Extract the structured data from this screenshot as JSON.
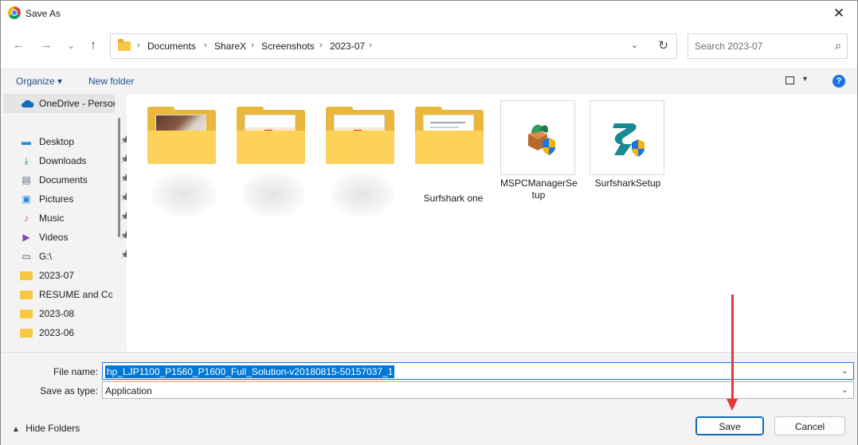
{
  "window": {
    "title": "Save As",
    "close": "✕",
    "app_icon": "chrome-icon"
  },
  "nav": {
    "back": "←",
    "forward": "→",
    "recent": "⌄",
    "up": "↑"
  },
  "address": {
    "crumbs": [
      "Documents",
      "ShareX",
      "Screenshots",
      "2023-07"
    ],
    "separator": "›",
    "dropdown": "⌄",
    "refresh": "↻"
  },
  "search": {
    "placeholder": "Search 2023-07",
    "icon": "⌕"
  },
  "commands": {
    "organize": "Organize ▾",
    "new_folder": "New folder",
    "view_dd": "▾",
    "help": "?"
  },
  "sidebar": {
    "onedrive": "OneDrive - Person",
    "items": [
      {
        "label": "Desktop",
        "icon": "desktop-icon",
        "glyph": "▬",
        "color": "#2b88d8",
        "pinned": true
      },
      {
        "label": "Downloads",
        "icon": "download-icon",
        "glyph": "⤓",
        "color": "#1e9e5c",
        "pinned": true
      },
      {
        "label": "Documents",
        "icon": "document-icon",
        "glyph": "▤",
        "color": "#5b6b84",
        "pinned": true
      },
      {
        "label": "Pictures",
        "icon": "pictures-icon",
        "glyph": "▣",
        "color": "#2b88d8",
        "pinned": true
      },
      {
        "label": "Music",
        "icon": "music-icon",
        "glyph": "♪",
        "color": "#e2574c",
        "pinned": true
      },
      {
        "label": "Videos",
        "icon": "videos-icon",
        "glyph": "▶",
        "color": "#8e44ad",
        "pinned": true
      },
      {
        "label": "G:\\",
        "icon": "drive-icon",
        "glyph": "▭",
        "color": "#555555",
        "pinned": true
      },
      {
        "label": "2023-07",
        "icon": "folder-icon",
        "glyph": "",
        "color": "#f7c843",
        "pinned": false
      },
      {
        "label": "RESUME and Cov",
        "icon": "folder-icon",
        "glyph": "",
        "color": "#f7c843",
        "pinned": false
      },
      {
        "label": "2023-08",
        "icon": "folder-icon",
        "glyph": "",
        "color": "#f7c843",
        "pinned": false
      },
      {
        "label": "2023-06",
        "icon": "folder-icon",
        "glyph": "",
        "color": "#f7c843",
        "pinned": false
      }
    ]
  },
  "files": [
    {
      "name": "",
      "kind": "folder"
    },
    {
      "name": "",
      "kind": "folder"
    },
    {
      "name": "",
      "kind": "folder"
    },
    {
      "name": "Surfshark one",
      "kind": "folder"
    },
    {
      "name": "MSPCManagerSe\ntup",
      "kind": "exe"
    },
    {
      "name": "SurfsharkSetup",
      "kind": "exe"
    }
  ],
  "form": {
    "file_name_label": "File name:",
    "file_name": "hp_LJP1100_P1560_P1600_Full_Solution-v20180815-50157037_1",
    "save_type_label": "Save as type:",
    "save_type": "Application",
    "dd": "⌄"
  },
  "footer": {
    "hide_folders": "Hide Folders",
    "save": "Save",
    "cancel": "Cancel"
  },
  "colors": {
    "accent": "#0078d7",
    "annotation": "#e53935",
    "folder": "#fcd25a"
  }
}
